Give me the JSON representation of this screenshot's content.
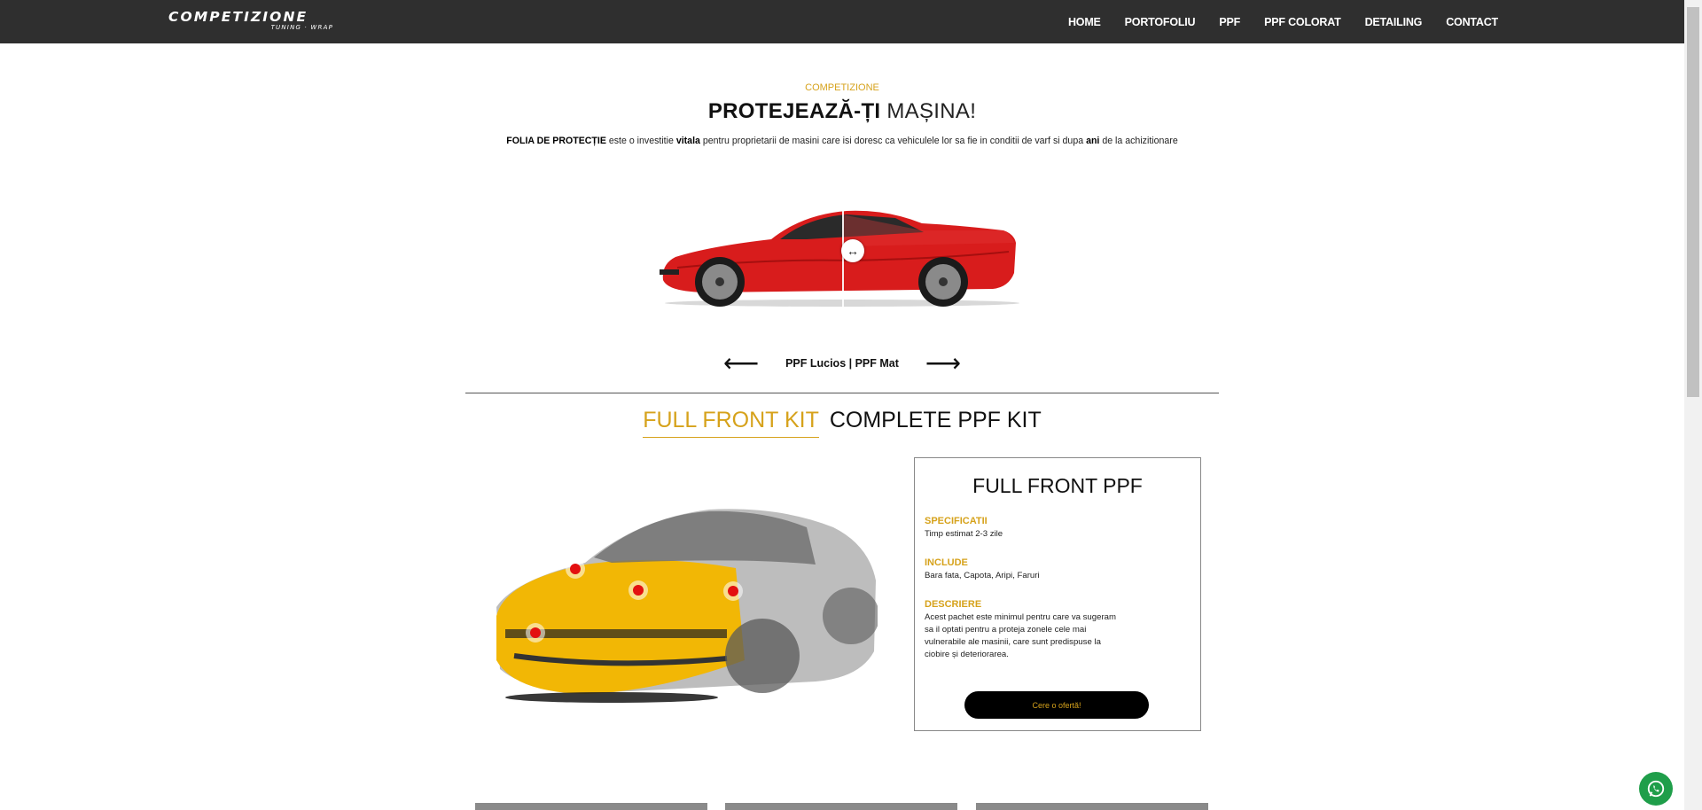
{
  "nav": {
    "logo_text": "COMPETIZIONE",
    "logo_sub": "TUNING · WRAP",
    "items": [
      "HOME",
      "PORTOFOLIU",
      "PPF",
      "PPF COLORAT",
      "DETAILING",
      "CONTACT"
    ]
  },
  "hero": {
    "eyebrow": "COMPETIZIONE",
    "title_bold": "PROTEJEAZĂ-ȚI",
    "title_rest": " MAȘINA!",
    "intro": {
      "b1": "FOLIA DE PROTECȚIE",
      "t1": " este o investitie ",
      "b2": "vitala",
      "t2": " pentru proprietarii de masini care isi doresc ca vehiculele lor sa fie in conditii de varf si dupa ",
      "b3": "ani",
      "t3": " de la achizitionare"
    }
  },
  "slider": {
    "label": "PPF Lucios | PPF Mat",
    "prev_icon": "arrow-left-icon",
    "next_icon": "arrow-right-icon"
  },
  "tabs": [
    "FULL FRONT KIT",
    "COMPLETE PPF KIT"
  ],
  "panel": {
    "title": "FULL FRONT PPF",
    "spec_label": "SPECIFICATII",
    "spec_text": "Timp estimat 2-3 zile",
    "include_label": "INCLUDE",
    "include_text": "Bara fata, Capota, Aripi, Faruri",
    "desc_label": "DESCRIERE",
    "desc_text": "Acest pachet este minimul pentru care va sugeram sa il optati pentru a proteja zonele cele mai vulnerabile ale masinii, care sunt predispuse la ciobire și deteriorarea.",
    "cta": "Cere o ofertă!"
  },
  "colors": {
    "accent": "#d6a21b",
    "topbar": "#2f2f2f",
    "hotspot": "#e31010",
    "car_red": "#d81c1c",
    "car_yellow": "#f2b705"
  }
}
